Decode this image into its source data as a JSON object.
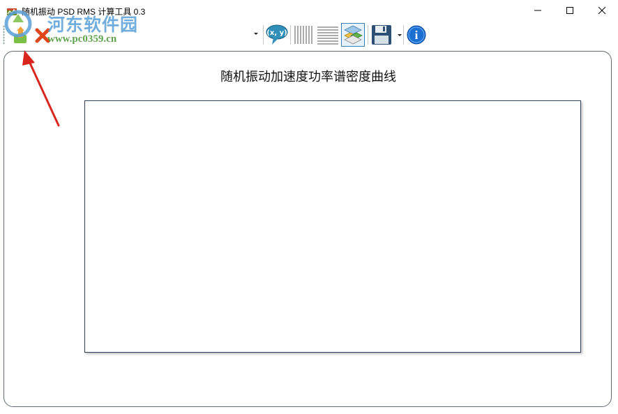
{
  "window": {
    "title": "随机振动 PSD RMS 计算工具 0.3",
    "controls": [
      "minimize",
      "maximize",
      "close"
    ]
  },
  "toolbar": {
    "file_combo_value": "",
    "buttons": [
      {
        "name": "open",
        "icon": "open-file-icon"
      },
      {
        "name": "close-file",
        "icon": "red-x-icon"
      },
      {
        "name": "coordinate",
        "icon": "coordinate-speech-icon",
        "label": "(x, y)"
      },
      {
        "name": "vertical-grid",
        "icon": "vertical-lines-icon"
      },
      {
        "name": "horizontal-grid",
        "icon": "horizontal-lines-icon"
      },
      {
        "name": "layers",
        "icon": "stacked-layers-icon",
        "active": true
      },
      {
        "name": "save",
        "icon": "floppy-disk-icon"
      },
      {
        "name": "about",
        "icon": "info-icon",
        "label": "i"
      }
    ]
  },
  "watermark": {
    "site_name": "河东软件园",
    "url": "www.pc0359.cn"
  },
  "chart": {
    "title": "随机振动加速度功率谱密度曲线"
  },
  "colors": {
    "panel_border": "#5f6a74",
    "plot_border": "#30405a",
    "annotation_arrow": "#d8261e",
    "info_blue": "#1a6fd1"
  }
}
